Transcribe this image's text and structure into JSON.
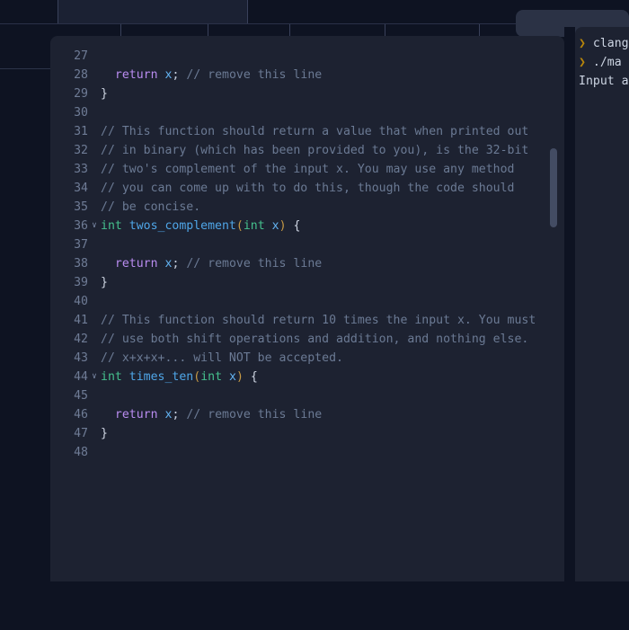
{
  "window": {
    "background_color": "#0e1322",
    "panel_color": "#1d2231"
  },
  "topbar": {
    "active_tab_label": "",
    "segments": [
      "",
      "",
      "",
      "",
      ""
    ],
    "right_pill_label": ""
  },
  "editor": {
    "scrollbar_name": "vertical-scrollbar",
    "first_visible_line": 27,
    "last_visible_line": 48,
    "lines": [
      {
        "num": "27",
        "fold": "",
        "tokens": []
      },
      {
        "num": "28",
        "fold": "",
        "tokens": [
          {
            "t": "  ",
            "c": "pun"
          },
          {
            "t": "return",
            "c": "kw"
          },
          {
            "t": " ",
            "c": "pun"
          },
          {
            "t": "x",
            "c": "var"
          },
          {
            "t": ";",
            "c": "pun"
          },
          {
            "t": " ",
            "c": "pun"
          },
          {
            "t": "// remove this line",
            "c": "cmt"
          }
        ]
      },
      {
        "num": "29",
        "fold": "",
        "tokens": [
          {
            "t": "}",
            "c": "brc"
          }
        ]
      },
      {
        "num": "30",
        "fold": "",
        "tokens": []
      },
      {
        "num": "31",
        "fold": "",
        "tokens": [
          {
            "t": "// This function should return a value that when printed out",
            "c": "cmt"
          }
        ]
      },
      {
        "num": "32",
        "fold": "",
        "tokens": [
          {
            "t": "// in binary (which has been provided to you), is the 32-bit",
            "c": "cmt"
          }
        ]
      },
      {
        "num": "33",
        "fold": "",
        "tokens": [
          {
            "t": "// two's complement of the input x. You may use any method",
            "c": "cmt"
          }
        ]
      },
      {
        "num": "34",
        "fold": "",
        "tokens": [
          {
            "t": "// you can come up with to do this, though the code should",
            "c": "cmt"
          }
        ]
      },
      {
        "num": "35",
        "fold": "",
        "tokens": [
          {
            "t": "// be concise.",
            "c": "cmt"
          }
        ]
      },
      {
        "num": "36",
        "fold": "∨",
        "tokens": [
          {
            "t": "int",
            "c": "typ"
          },
          {
            "t": " ",
            "c": "pun"
          },
          {
            "t": "twos_complement",
            "c": "fnm"
          },
          {
            "t": "(",
            "c": "par"
          },
          {
            "t": "int",
            "c": "typ"
          },
          {
            "t": " ",
            "c": "pun"
          },
          {
            "t": "x",
            "c": "var"
          },
          {
            "t": ")",
            "c": "par"
          },
          {
            "t": " ",
            "c": "pun"
          },
          {
            "t": "{",
            "c": "brc"
          }
        ]
      },
      {
        "num": "37",
        "fold": "",
        "tokens": []
      },
      {
        "num": "38",
        "fold": "",
        "tokens": [
          {
            "t": "  ",
            "c": "pun"
          },
          {
            "t": "return",
            "c": "kw"
          },
          {
            "t": " ",
            "c": "pun"
          },
          {
            "t": "x",
            "c": "var"
          },
          {
            "t": ";",
            "c": "pun"
          },
          {
            "t": " ",
            "c": "pun"
          },
          {
            "t": "// remove this line",
            "c": "cmt"
          }
        ]
      },
      {
        "num": "39",
        "fold": "",
        "tokens": [
          {
            "t": "}",
            "c": "brc"
          }
        ]
      },
      {
        "num": "40",
        "fold": "",
        "tokens": []
      },
      {
        "num": "41",
        "fold": "",
        "tokens": [
          {
            "t": "// This function should return 10 times the input x. You must",
            "c": "cmt"
          }
        ]
      },
      {
        "num": "42",
        "fold": "",
        "tokens": [
          {
            "t": "// use both shift operations and addition, and nothing else.",
            "c": "cmt"
          }
        ]
      },
      {
        "num": "43",
        "fold": "",
        "tokens": [
          {
            "t": "// x+x+x+... will NOT be accepted.",
            "c": "cmt"
          }
        ]
      },
      {
        "num": "44",
        "fold": "∨",
        "tokens": [
          {
            "t": "int",
            "c": "typ"
          },
          {
            "t": " ",
            "c": "pun"
          },
          {
            "t": "times_ten",
            "c": "fnm"
          },
          {
            "t": "(",
            "c": "par"
          },
          {
            "t": "int",
            "c": "typ"
          },
          {
            "t": " ",
            "c": "pun"
          },
          {
            "t": "x",
            "c": "var"
          },
          {
            "t": ")",
            "c": "par"
          },
          {
            "t": " ",
            "c": "pun"
          },
          {
            "t": "{",
            "c": "brc"
          }
        ]
      },
      {
        "num": "45",
        "fold": "",
        "tokens": []
      },
      {
        "num": "46",
        "fold": "",
        "tokens": [
          {
            "t": "  ",
            "c": "pun"
          },
          {
            "t": "return",
            "c": "kw"
          },
          {
            "t": " ",
            "c": "pun"
          },
          {
            "t": "x",
            "c": "var"
          },
          {
            "t": ";",
            "c": "pun"
          },
          {
            "t": " ",
            "c": "pun"
          },
          {
            "t": "// remove this line",
            "c": "cmt"
          }
        ]
      },
      {
        "num": "47",
        "fold": "",
        "tokens": [
          {
            "t": "}",
            "c": "brc"
          }
        ]
      },
      {
        "num": "48",
        "fold": "",
        "tokens": []
      }
    ]
  },
  "terminal": {
    "lines": [
      {
        "prompt": "❯ ",
        "text": "clang"
      },
      {
        "prompt": "❯ ",
        "text": "./ma"
      },
      {
        "prompt": "",
        "text": "Input a"
      }
    ]
  },
  "colors": {
    "comment": "#6b7a94",
    "keyword": "#b98cf0",
    "type": "#45c08d",
    "function": "#4fa6e8",
    "variable": "#63b3f2",
    "paren": "#c79a45",
    "line_number": "#6f7c96",
    "scrollbar_thumb": "#434c63"
  }
}
